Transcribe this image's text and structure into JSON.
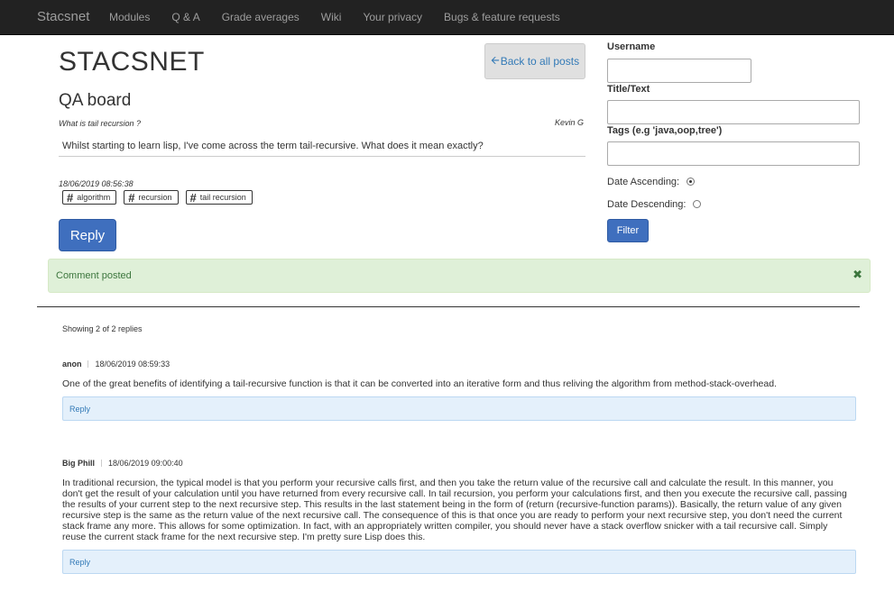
{
  "navbar": {
    "brand": "Stacsnet",
    "links": [
      "Modules",
      "Q & A",
      "Grade averages",
      "Wiki",
      "Your privacy",
      "Bugs & feature requests"
    ]
  },
  "header": {
    "site_title": "STACSNET",
    "back_button": "Back to all posts",
    "board_title": "QA board"
  },
  "post": {
    "subtitle": "What is tail recursion ?",
    "author": "Kevin G",
    "body": "Whilst starting to learn lisp, I've come across the term tail-recursive. What does it mean exactly?",
    "date": "18/06/2019 08:56:38",
    "tags": [
      "algorithm",
      "recursion",
      "tail recursion"
    ],
    "reply_button": "Reply"
  },
  "filter": {
    "username_label": "Username",
    "username_value": "",
    "title_label": "Title/Text",
    "title_value": "",
    "tags_label": "Tags (e.g 'java,oop,tree')",
    "tags_value": "",
    "date_ascending_label": "Date Ascending:",
    "date_ascending_checked": true,
    "date_descending_label": "Date Descending:",
    "date_descending_checked": false,
    "filter_button": "Filter"
  },
  "alert": {
    "text": "Comment posted",
    "close": "✖"
  },
  "replies": {
    "showing": "Showing 2 of 2 replies",
    "items": [
      {
        "author": "anon",
        "date": "18/06/2019 08:59:33",
        "text": "One of the great benefits of identifying a tail-recursive function is that it can be converted into an iterative form and thus reliving the algorithm from method-stack-overhead.",
        "reply_link": "Reply"
      },
      {
        "author": "Big Phill",
        "date": "18/06/2019 09:00:40",
        "text": "In traditional recursion, the typical model is that you perform your recursive calls first, and then you take the return value of the recursive call and calculate the result. In this manner, you don't get the result of your calculation until you have returned from every recursive call.  In tail recursion, you perform your calculations first, and then you execute the recursive call, passing the results of your current step to the next recursive step. This results in the last statement being in the form of (return (recursive-function params)). Basically, the return value of any given recursive step is the same as the return value of the next recursive call.  The consequence of this is that once you are ready to perform your next recursive step, you don't need the current stack frame any more. This allows for some optimization. In fact, with an appropriately written compiler, you should never have a stack overflow snicker with a tail recursive call. Simply reuse the current stack frame for the next recursive step. I'm pretty sure Lisp does this.",
        "reply_link": "Reply"
      }
    ]
  },
  "colors": {
    "navbar_bg": "#222222",
    "primary_button": "#3f6fbe",
    "alert_bg": "#dff0d8",
    "alert_text": "#3c763d",
    "reply_bar_bg": "#e4f0fb",
    "link": "#337ab7"
  }
}
